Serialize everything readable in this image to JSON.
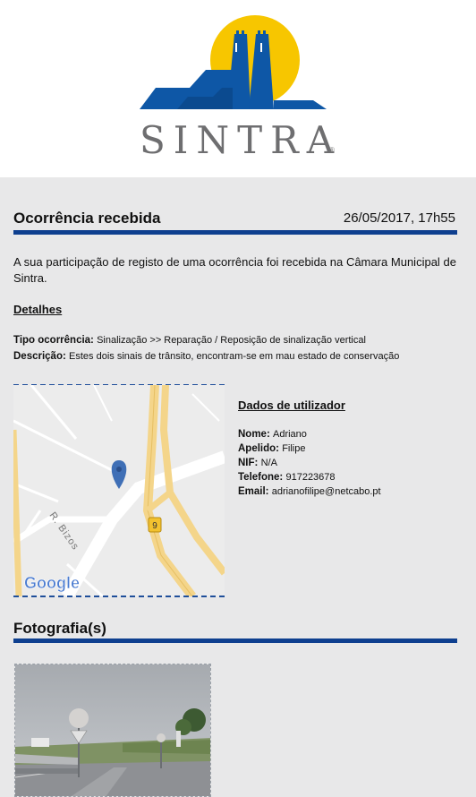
{
  "brand": {
    "logo_text": "SINTRA",
    "logo_mark": "®",
    "colors": {
      "sun": "#f7c600",
      "blue": "#0e57a6",
      "grey": "#6e6e70"
    }
  },
  "occurrence": {
    "title": "Ocorrência recebida",
    "datetime": "26/05/2017, 17h55",
    "message": "A sua participação de registo de uma ocorrência foi recebida na Câmara Municipal de Sintra."
  },
  "details": {
    "heading": "Detalhes",
    "type_label": "Tipo ocorrência:",
    "type_value": "Sinalização >> Reparação / Reposição de sinalização vertical",
    "description_label": "Descrição:",
    "description_value": "Estes dois sinais de trânsito, encontram-se em mau estado de conservação"
  },
  "map": {
    "street_label": "R. Bizos",
    "road_shield": "9",
    "provider": "Google"
  },
  "user": {
    "heading": "Dados de utilizador",
    "fields": [
      {
        "label": "Nome:",
        "value": "Adriano"
      },
      {
        "label": "Apelido:",
        "value": "Filipe"
      },
      {
        "label": "NIF:",
        "value": "N/A"
      },
      {
        "label": "Telefone:",
        "value": "917223678"
      },
      {
        "label": "Email:",
        "value": "adrianofilipe@netcabo.pt"
      }
    ]
  },
  "photos": {
    "title": "Fotografia(s)"
  }
}
